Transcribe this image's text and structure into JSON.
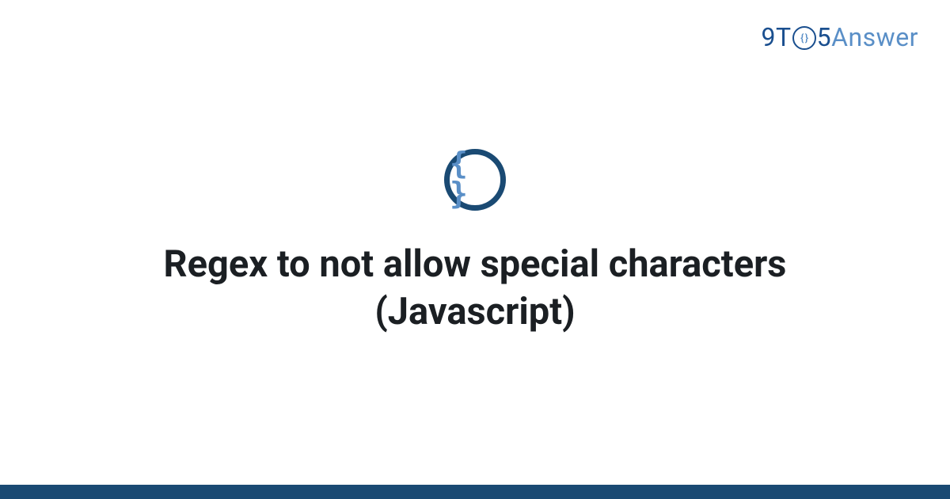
{
  "logo": {
    "part1": "9",
    "part2": "T",
    "o_inner": "{ }",
    "part4": "5",
    "part5": "Answer"
  },
  "badge": {
    "glyph": "{ }"
  },
  "title": "Regex to not allow special characters (Javascript)"
}
